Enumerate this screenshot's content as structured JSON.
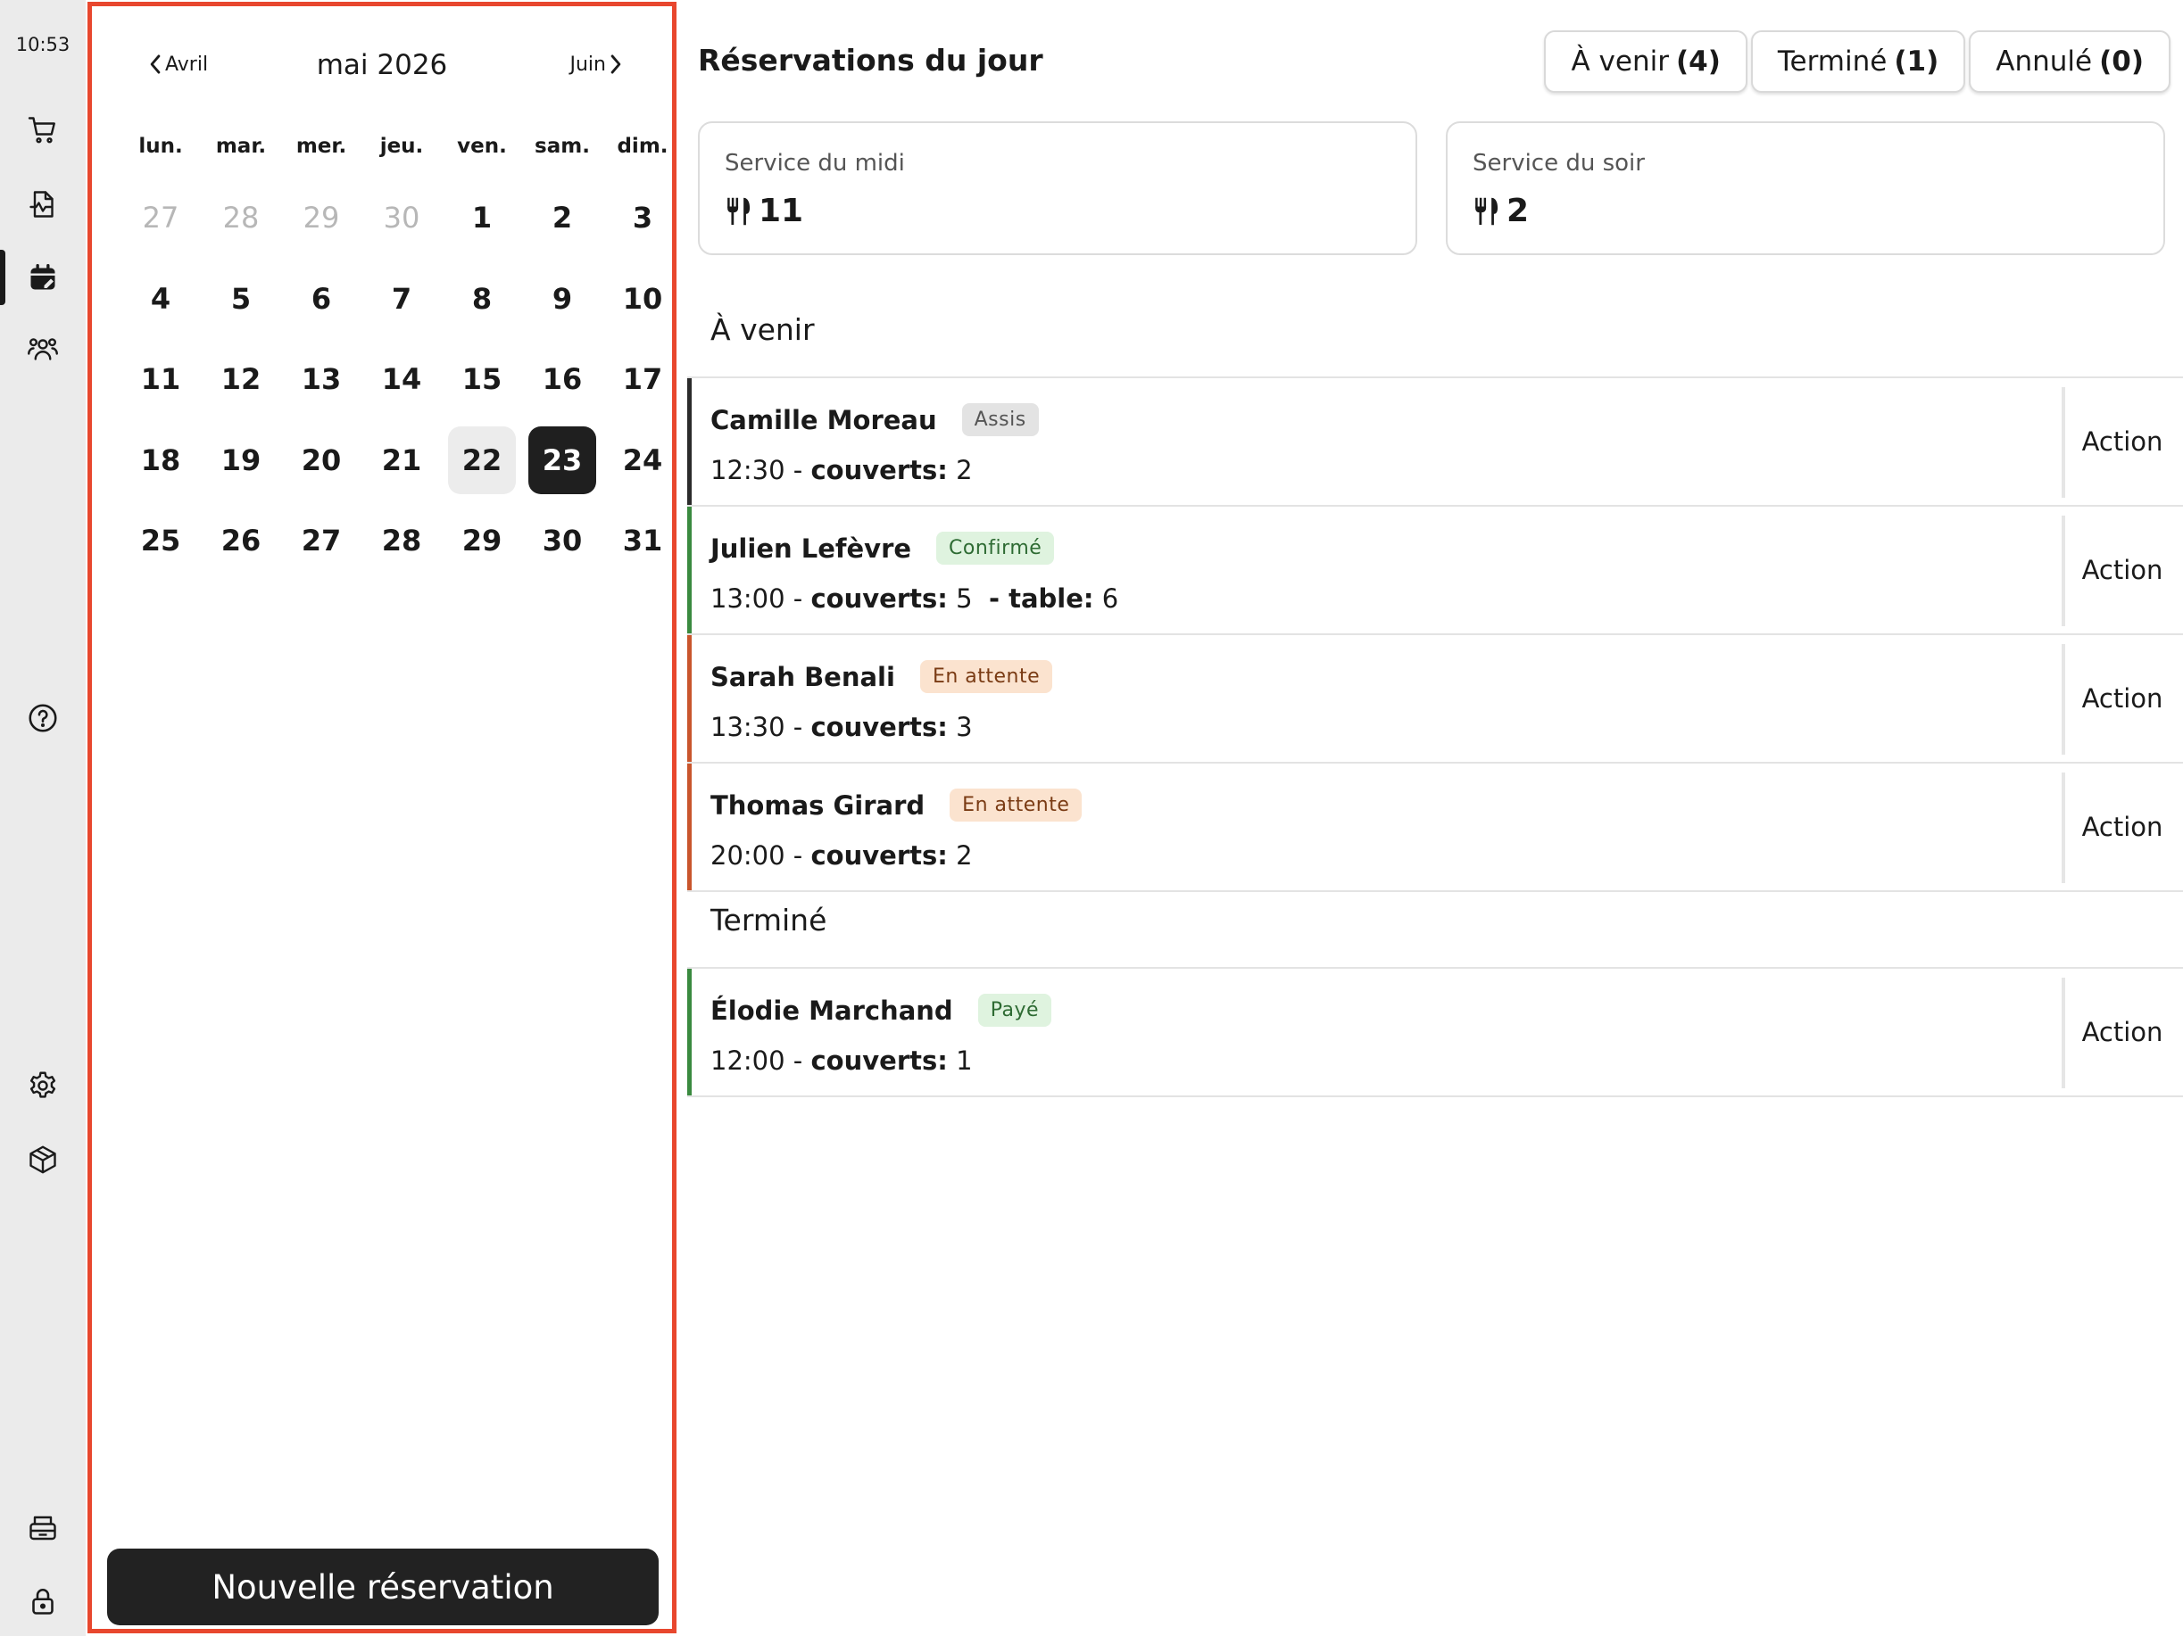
{
  "sidebar": {
    "time": "10:53",
    "items": [
      {
        "icon": "cart-icon"
      },
      {
        "icon": "document-chart-icon"
      },
      {
        "icon": "calendar-icon",
        "active": true
      },
      {
        "icon": "users-icon"
      },
      {
        "icon": "help-icon"
      },
      {
        "icon": "settings-icon"
      },
      {
        "icon": "box-icon"
      },
      {
        "icon": "printer-icon"
      },
      {
        "icon": "lock-icon"
      }
    ]
  },
  "calendar": {
    "prev_label": "Avril",
    "next_label": "Juin",
    "month_title": "mai 2026",
    "weekdays": [
      "lun.",
      "mar.",
      "mer.",
      "jeu.",
      "ven.",
      "sam.",
      "dim."
    ],
    "weeks": [
      [
        "27",
        "28",
        "29",
        "30",
        "1",
        "2",
        "3"
      ],
      [
        "4",
        "5",
        "6",
        "7",
        "8",
        "9",
        "10"
      ],
      [
        "11",
        "12",
        "13",
        "14",
        "15",
        "16",
        "17"
      ],
      [
        "18",
        "19",
        "20",
        "21",
        "22",
        "23",
        "24"
      ],
      [
        "25",
        "26",
        "27",
        "28",
        "29",
        "30",
        "31"
      ]
    ],
    "muted_days_first_week": 4,
    "today": "22",
    "selected": "23",
    "new_button": "Nouvelle réservation"
  },
  "main": {
    "title": "Réservations du jour",
    "filters": [
      {
        "label": "À venir",
        "count": "(4)"
      },
      {
        "label": "Terminé",
        "count": "(1)"
      },
      {
        "label": "Annulé",
        "count": "(0)"
      }
    ],
    "services": [
      {
        "label": "Service du midi",
        "count": "11"
      },
      {
        "label": "Service du soir",
        "count": "2"
      }
    ],
    "sections": [
      {
        "title": "À venir",
        "reservations": [
          {
            "name": "Camille Moreau",
            "status": "Assis",
            "status_bg": "#e3e3e3",
            "status_fg": "#555555",
            "accent": "#2b2b2b",
            "time": "12:30",
            "covers_label": "couverts:",
            "covers": "2",
            "table_label": "",
            "table": "",
            "action": "Action"
          },
          {
            "name": "Julien  Lefèvre",
            "status": "Confirmé",
            "status_bg": "#dff3df",
            "status_fg": "#2e6b33",
            "accent": "#3a8a3f",
            "time": "13:00",
            "covers_label": "couverts:",
            "covers": "5",
            "table_label": "- table:",
            "table": "6",
            "action": "Action"
          },
          {
            "name": "Sarah Benali",
            "status": "En attente",
            "status_bg": "#fbe3cf",
            "status_fg": "#7a3b14",
            "accent": "#c9552c",
            "time": "13:30",
            "covers_label": "couverts:",
            "covers": "3",
            "table_label": "",
            "table": "",
            "action": "Action"
          },
          {
            "name": "Thomas Girard",
            "status": "En attente",
            "status_bg": "#fbe3cf",
            "status_fg": "#7a3b14",
            "accent": "#c9552c",
            "time": "20:00",
            "covers_label": "couverts:",
            "covers": "2",
            "table_label": "",
            "table": "",
            "action": "Action"
          }
        ]
      },
      {
        "title": "Terminé",
        "reservations": [
          {
            "name": "Élodie Marchand",
            "status": "Payé",
            "status_bg": "#dff3df",
            "status_fg": "#2e6b33",
            "accent": "#3a8a3f",
            "time": "12:00",
            "covers_label": "couverts:",
            "covers": "1",
            "table_label": "",
            "table": "",
            "action": "Action"
          }
        ]
      }
    ]
  }
}
